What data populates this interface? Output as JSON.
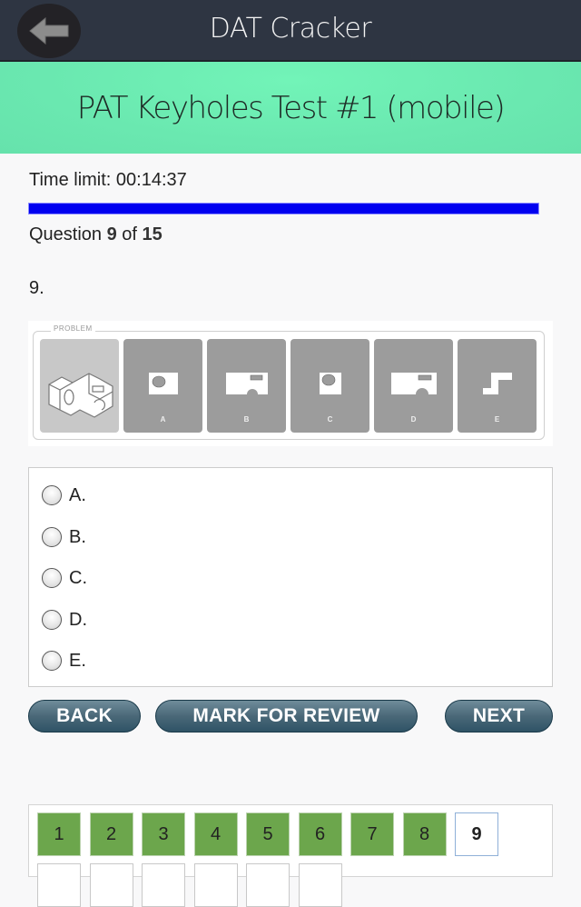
{
  "header": {
    "app_title": "DAT Cracker",
    "back_icon": "arrow-left-icon"
  },
  "banner": {
    "test_title": "PAT Keyholes Test #1 (mobile)"
  },
  "status": {
    "time_limit_label": "Time limit: 00:14:37",
    "progress_fraction": 1.0,
    "progress_color": "#0000f0",
    "question_prefix": "Question ",
    "question_current": "9",
    "question_mid": " of ",
    "question_total": "15"
  },
  "question": {
    "number_label": "9.",
    "image": {
      "frame_label": "PROBLEM",
      "tiles": [
        {
          "label": "",
          "icon": "isometric-block-problem-icon"
        },
        {
          "label": "A",
          "icon": "rect-with-circle-hole-icon"
        },
        {
          "label": "B",
          "icon": "wide-rect-with-slot-and-arch-icon"
        },
        {
          "label": "C",
          "icon": "square-with-circle-hole-icon"
        },
        {
          "label": "D",
          "icon": "wide-rect-with-slot-and-arch-icon"
        },
        {
          "label": "E",
          "icon": "step-shape-icon"
        }
      ]
    }
  },
  "answers": [
    {
      "label": "A.",
      "selected": false
    },
    {
      "label": "B.",
      "selected": false
    },
    {
      "label": "C.",
      "selected": false
    },
    {
      "label": "D.",
      "selected": false
    },
    {
      "label": "E.",
      "selected": false
    }
  ],
  "buttons": {
    "back": "BACK",
    "mark_for_review": "MARK FOR REVIEW",
    "next": "NEXT"
  },
  "navigator": {
    "cells": [
      {
        "label": "1",
        "state": "answered"
      },
      {
        "label": "2",
        "state": "answered"
      },
      {
        "label": "3",
        "state": "answered"
      },
      {
        "label": "4",
        "state": "answered"
      },
      {
        "label": "5",
        "state": "answered"
      },
      {
        "label": "6",
        "state": "answered"
      },
      {
        "label": "7",
        "state": "answered"
      },
      {
        "label": "8",
        "state": "answered"
      },
      {
        "label": "9",
        "state": "current"
      },
      {
        "label": "",
        "state": "empty"
      },
      {
        "label": "",
        "state": "empty"
      },
      {
        "label": "",
        "state": "empty"
      },
      {
        "label": "",
        "state": "empty"
      },
      {
        "label": "",
        "state": "empty"
      },
      {
        "label": "",
        "state": "empty"
      }
    ],
    "answered_color": "#6ca64c"
  }
}
